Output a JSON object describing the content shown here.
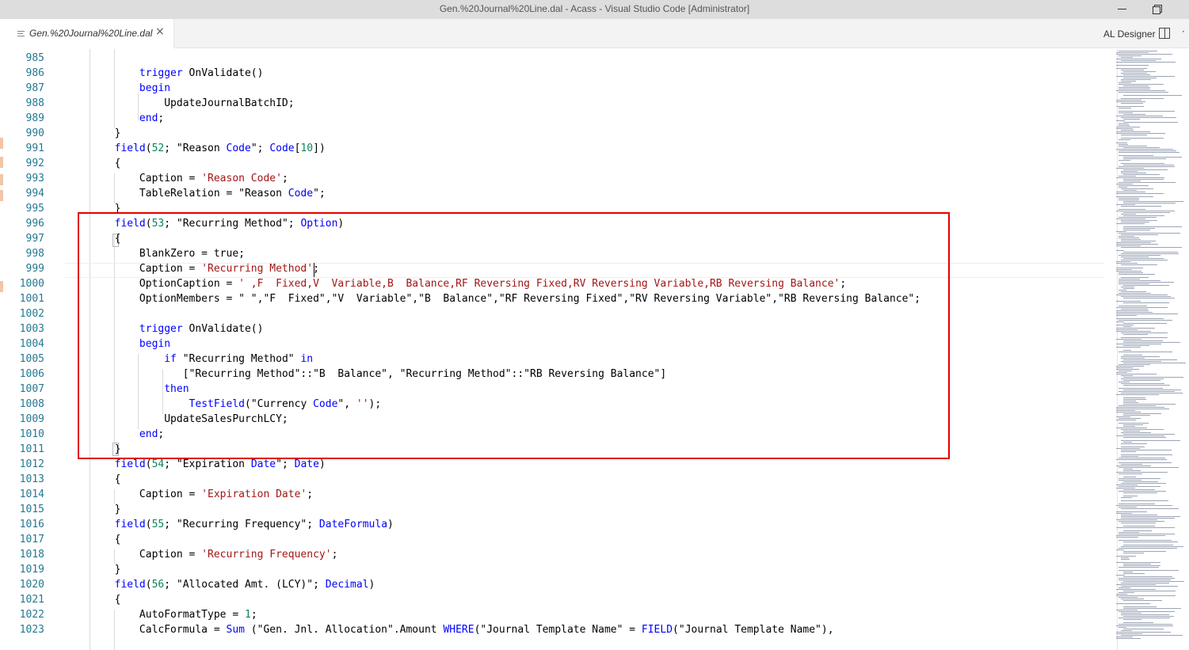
{
  "window": {
    "title": "Gen.%20Journal%20Line.dal - Acass - Visual Studio Code [Administrator]"
  },
  "tab": {
    "label": "Gen.%20Journal%20Line.dal",
    "close_glyph": "×",
    "icon": "file-lines-icon"
  },
  "toolbar": {
    "al_designer_label": "AL Designer",
    "split_icon": "split-editor-icon",
    "more_glyph": "·"
  },
  "editor": {
    "current_line": 999,
    "lines": [
      {
        "n": "985",
        "code": ""
      },
      {
        "n": "986",
        "code": "            trigger OnValidate()"
      },
      {
        "n": "987",
        "code": "            begin"
      },
      {
        "n": "988",
        "code": "                UpdateJournalBatchID;"
      },
      {
        "n": "989",
        "code": "            end;"
      },
      {
        "n": "990",
        "code": "        }"
      },
      {
        "n": "991",
        "code": "        field(52; \"Reason Code\"; Code[10])"
      },
      {
        "n": "992",
        "code": "        {"
      },
      {
        "n": "993",
        "code": "            Caption = 'Reason Code';"
      },
      {
        "n": "994",
        "code": "            TableRelation = \"Reason Code\";"
      },
      {
        "n": "995",
        "code": "        }"
      },
      {
        "n": "996",
        "code": "        field(53; \"Recurring Method\"; Option)"
      },
      {
        "n": "997",
        "code": "        {"
      },
      {
        "n": "998",
        "code": "            BlankZero = true;"
      },
      {
        "n": "999",
        "code": "            Caption = 'Recurring Method';"
      },
      {
        "n": "1000",
        "code": "            OptionCaption = ' ,F  Fixed,V  Variable,B  Balance,RF Reversing Fixed,RV Reversing Variable,RB Reversing Balance';"
      },
      {
        "n": "1001",
        "code": "            OptionMembers = \" \",\"F  Fixed\",\"V  Variable\",\"B  Balance\",\"RF Reversing Fixed\",\"RV Reversing Variable\",\"RB Reversing Balance\";"
      },
      {
        "n": "1002",
        "code": ""
      },
      {
        "n": "1003",
        "code": "            trigger OnValidate()"
      },
      {
        "n": "1004",
        "code": "            begin"
      },
      {
        "n": "1005",
        "code": "                if \"Recurring Method\" in"
      },
      {
        "n": "1006",
        "code": "                   [\"Recurring Method\"::\"B  Balance\", \"Recurring Method\"::\"RB Reversing Balance\"]"
      },
      {
        "n": "1007",
        "code": "                then"
      },
      {
        "n": "1008",
        "code": "                    TestField(\"Currency Code\", '');"
      },
      {
        "n": "1009",
        "code": "                UpdateSalesPurchLCY;"
      },
      {
        "n": "1010",
        "code": "            end;"
      },
      {
        "n": "1011",
        "code": "        }"
      },
      {
        "n": "1012",
        "code": "        field(54; \"Expiration Date\"; Date)"
      },
      {
        "n": "1013",
        "code": "        {"
      },
      {
        "n": "1014",
        "code": "            Caption = 'Expiration Date';"
      },
      {
        "n": "1015",
        "code": "        }"
      },
      {
        "n": "1016",
        "code": "        field(55; \"Recurring Frequency\"; DateFormula)"
      },
      {
        "n": "1017",
        "code": "        {"
      },
      {
        "n": "1018",
        "code": "            Caption = 'Recurring Frequency';"
      },
      {
        "n": "1019",
        "code": "        }"
      },
      {
        "n": "1020",
        "code": "        field(56; \"Allocated Amt. (LCY)\"; Decimal)"
      },
      {
        "n": "1021",
        "code": "        {"
      },
      {
        "n": "1022",
        "code": "            AutoFormatType = 1;"
      },
      {
        "n": "1023",
        "code": "            CalcFormula = Sum (\"Gen. Jnl. Allocation\".Amount WHERE(\"Journal Template Name\" = FIELD(\"Journal Template Name\"),"
      }
    ]
  },
  "colors": {
    "keyword": "#0000ff",
    "string": "#a31515",
    "number": "#098658",
    "line_number": "#237893",
    "highlight_box": "#e00000"
  }
}
